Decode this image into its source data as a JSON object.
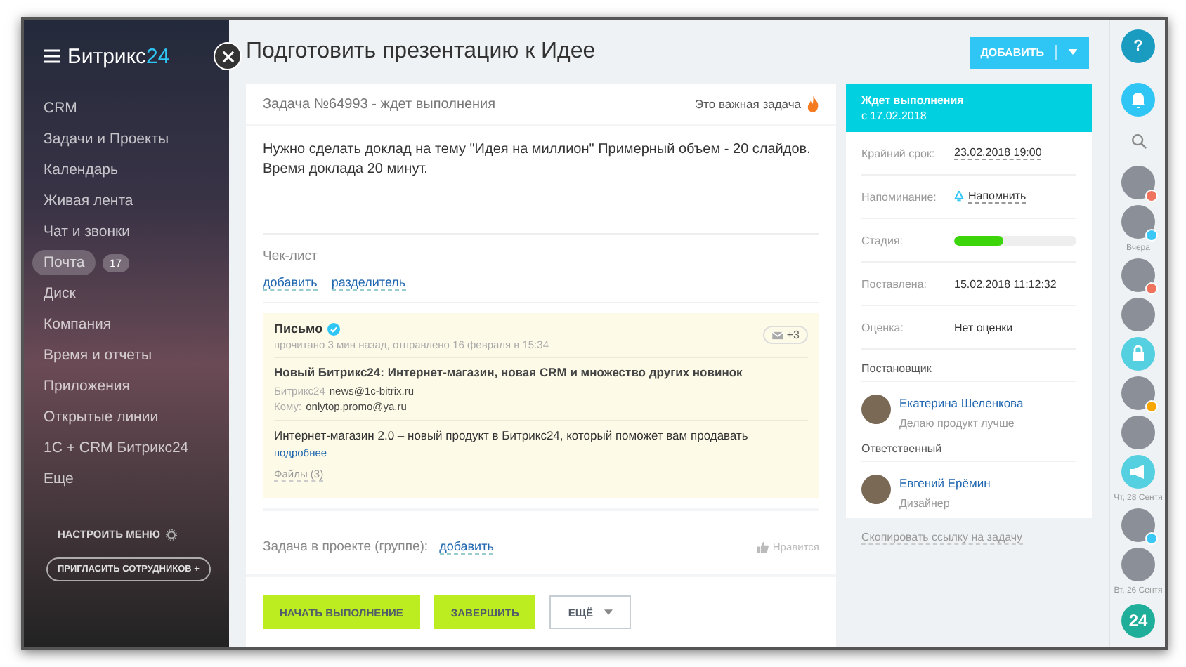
{
  "sidebar": {
    "logo": {
      "name": "Битрикс",
      "suffix": "24"
    },
    "items": [
      {
        "label": "CRM",
        "selected": false
      },
      {
        "label": "Задачи и Проекты",
        "selected": false
      },
      {
        "label": "Календарь",
        "selected": false
      },
      {
        "label": "Живая лента",
        "selected": false
      },
      {
        "label": "Чат и звонки",
        "selected": false
      },
      {
        "label": "Почта",
        "selected": true,
        "counter": "17"
      },
      {
        "label": "Диск",
        "selected": false
      },
      {
        "label": "Компания",
        "selected": false
      },
      {
        "label": "Время и отчеты",
        "selected": false
      },
      {
        "label": "Приложения",
        "selected": false
      },
      {
        "label": "Открытые линии",
        "selected": false
      },
      {
        "label": "1С + CRM Битрикс24",
        "selected": false
      },
      {
        "label": "Еще",
        "selected": false
      }
    ],
    "configure": "НАСТРОИТЬ МЕНЮ",
    "invite": "ПРИГЛАСИТЬ СОТРУДНИКОВ +"
  },
  "page": {
    "title": "Подготовить презентацию к Идее",
    "add_button": "ДОБАВИТЬ"
  },
  "task": {
    "header": "Задача №64993 - ждет выполнения",
    "important": true,
    "important_label": "Это важная задача",
    "description": "Нужно сделать доклад на тему \"Идея на миллион\" Примерный объем - 20 слайдов. Время доклада 20 минут.",
    "checklist": {
      "title": "Чек-лист",
      "links": [
        "добавить",
        "разделитель"
      ]
    },
    "email": {
      "title": "Письмо",
      "verified": true,
      "meta": "прочитано 3 мин назад, отправлено 16 февраля в 15:34",
      "counter": "+3",
      "subject": "Новый Битрикс24: Интернет-магазин, новая CRM и множество других новинок",
      "from_label": "Битрикс24",
      "from": "news@1c-bitrix.ru",
      "to_label": "Кому:",
      "to": "onlytop.promo@ya.ru",
      "body": "Интернет-магазин 2.0 – новый продукт в Битрикс24, который поможет вам продавать",
      "more": "подробнее",
      "files": "Файлы (3)"
    },
    "project": {
      "label": "Задача в проекте (группе):",
      "link": "добавить",
      "like": "Нравится"
    },
    "buttons": [
      {
        "label": "НАЧАТЬ ВЫПОЛНЕНИЕ",
        "kind": "primary"
      },
      {
        "label": "ЗАВЕРШИТЬ",
        "kind": "primary"
      },
      {
        "label": "ЕЩЁ",
        "kind": "menu"
      }
    ]
  },
  "status": {
    "title": "Ждет выполнения",
    "since": "с 17.02.2018",
    "fields": [
      {
        "kind": "date",
        "label": "Крайний срок:",
        "value": "23.02.2018 19:00"
      },
      {
        "kind": "reminder",
        "label": "Напоминание:",
        "value": "Напомнить"
      },
      {
        "kind": "stage",
        "label": "Стадия:",
        "level": 0.4
      },
      {
        "kind": "text",
        "label": "Поставлена:",
        "value": "15.02.2018 11:12:32"
      },
      {
        "kind": "text",
        "label": "Оценка:",
        "value": "Нет оценки"
      }
    ],
    "people": [
      {
        "role": "Постановщик",
        "name": "Екатерина Шеленкова",
        "position": "Делаю продукт лучше"
      },
      {
        "role": "Ответственный",
        "name": "Евгений Ерёмин",
        "position": "Дизайнер"
      }
    ],
    "copy_link": "Скопировать ссылку на задачу"
  },
  "rail": [
    {
      "kind": "help",
      "label": "?"
    },
    {
      "kind": "bell"
    },
    {
      "kind": "search"
    },
    {
      "kind": "avatar",
      "color": "#f0735e"
    },
    {
      "kind": "avatar",
      "color": "#3bc8f5"
    },
    {
      "kind": "label",
      "label": "Вчера"
    },
    {
      "kind": "avatar",
      "color": "#f0735e"
    },
    {
      "kind": "avatar"
    },
    {
      "kind": "lock"
    },
    {
      "kind": "avatar",
      "color": "#f7a700"
    },
    {
      "kind": "avatar"
    },
    {
      "kind": "megaphone"
    },
    {
      "kind": "label",
      "label": "Чт, 28 Сентя"
    },
    {
      "kind": "avatar",
      "color": "#3bc8f5"
    },
    {
      "kind": "avatar"
    },
    {
      "kind": "label",
      "label": "Вт, 26 Сентя"
    },
    {
      "kind": "logo",
      "label": "24"
    }
  ]
}
